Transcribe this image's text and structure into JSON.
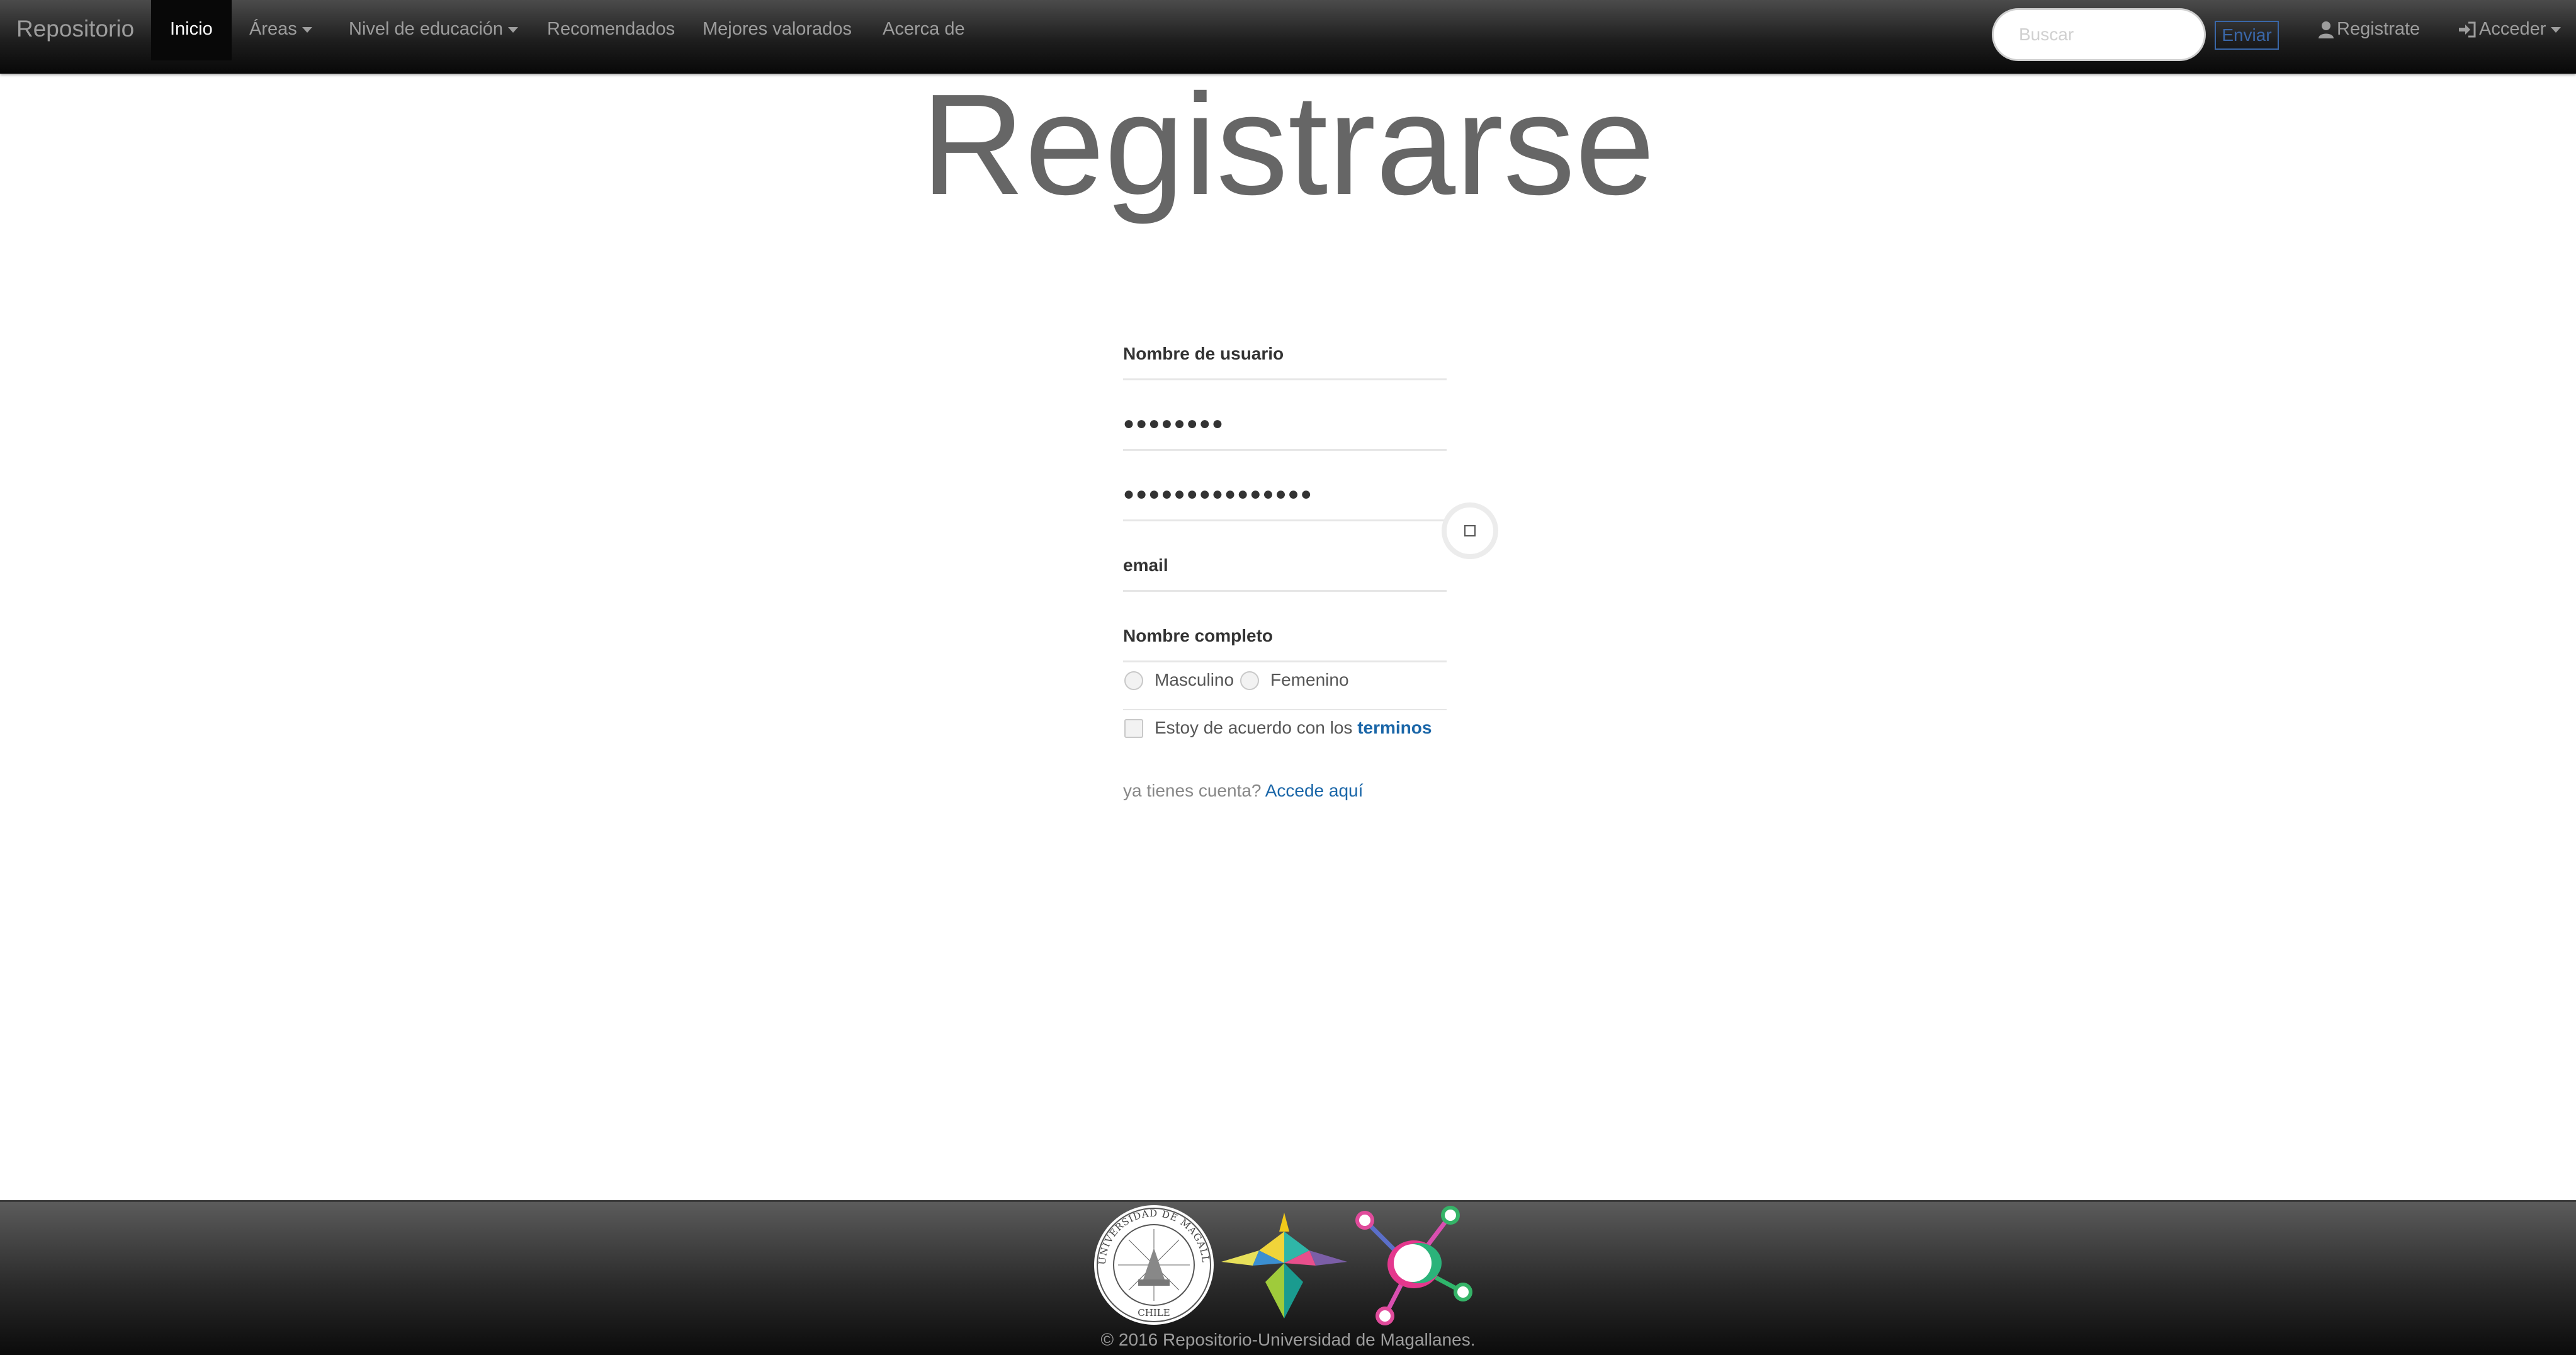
{
  "navbar": {
    "brand": "Repositorio",
    "items": [
      {
        "label": "Inicio",
        "active": true
      },
      {
        "label": "Áreas",
        "dropdown": true
      },
      {
        "label": "Nivel de educación",
        "dropdown": true
      },
      {
        "label": "Recomendados"
      },
      {
        "label": "Mejores valorados"
      },
      {
        "label": "Acerca de"
      }
    ],
    "search": {
      "placeholder": "Buscar",
      "value": ""
    },
    "send_label": "Enviar",
    "register_label": "Registrate",
    "register_icon": "user-icon",
    "login_label": "Acceder",
    "login_icon": "sign-in-icon"
  },
  "page": {
    "title": "Registrarse"
  },
  "form": {
    "username_label": "Nombre de usuario",
    "password_mask": "●●●●●●●●",
    "password_confirm_mask": "●●●●●●●●●●●●●●●",
    "email_label": "email",
    "fullname_label": "Nombre completo",
    "gender_options": [
      "Masculino",
      "Femenino"
    ],
    "terms_prefix": "Estoy de acuerdo con los",
    "terms_link": "terminos",
    "login_hint": "ya tienes cuenta?",
    "login_link": "Accede aquí"
  },
  "footer": {
    "copyright": "© 2016 Repositorio-Universidad de Magallanes.",
    "logos": [
      "universidad-de-magallanes-seal",
      "colorful-figure-logo",
      "network-nodes-logo"
    ],
    "seal_text": "UNIVERSIDAD DE MAGALLANES CHILE"
  },
  "colors": {
    "navbar": "#1e1e1e",
    "nav_text": "#9d9d9d",
    "link": "#1a66a8",
    "title": "#666666"
  }
}
